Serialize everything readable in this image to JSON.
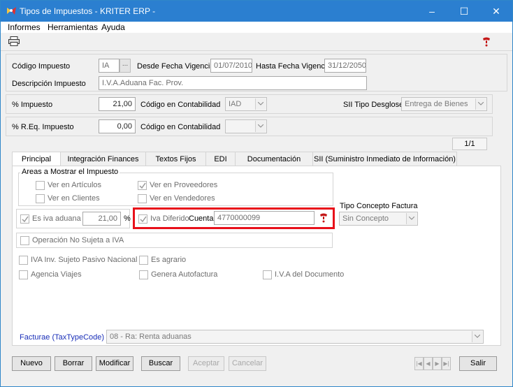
{
  "window": {
    "title": "Tipos de Impuestos - KRITER ERP -",
    "minimize": "–",
    "maximize": "☐",
    "close": "✕"
  },
  "menu": [
    "Informes",
    "Herramientas",
    "Ayuda"
  ],
  "header": {
    "codigo_label": "Código Impuesto",
    "codigo_value": "IA",
    "lookup_button": "...",
    "desde_label": "Desde Fecha Vigencia",
    "desde_value": "01/07/2010",
    "hasta_label": "Hasta Fecha Vigencia",
    "hasta_value": "31/12/2050",
    "descripcion_label": "Descripción Impuesto",
    "descripcion_value": "I.V.A.Aduana Fac. Prov."
  },
  "impuesto": {
    "pct_label": "% Impuesto",
    "pct_value": "21,00",
    "cont_label": "Código en Contabilidad",
    "cont_value": "IAD",
    "sii_label": "SII Tipo Desglose",
    "sii_value": "Entrega de Bienes"
  },
  "req": {
    "pct_label": "% R.Eq. Impuesto",
    "pct_value": "0,00",
    "cont_label": "Código en Contabilidad",
    "cont_value": ""
  },
  "record_counter": "1/1",
  "tabs": [
    "Principal",
    "Integración Finances",
    "Textos Fijos",
    "EDI",
    "Documentación",
    "SII (Suministro Inmediato de Información)"
  ],
  "principal": {
    "areas_title": "Areas a Mostrar el Impuesto",
    "areas": {
      "articulos": "Ver en Artículos",
      "proveedores": "Ver en Proveedores",
      "clientes": "Ver en Clientes",
      "vendedores": "Ver en Vendedores"
    },
    "es_iva_aduana": "Es iva aduana",
    "iva_aduana_value": "21,00",
    "pct_sign": "%",
    "iva_diferido": "Iva Diferido",
    "cuenta_label": "Cuenta",
    "cuenta_value": "4770000099",
    "tipo_concepto_label": "Tipo Concepto Factura",
    "tipo_concepto_value": "Sin Concepto",
    "operacion_no_sujeta": "Operación No Sujeta a IVA",
    "iva_inv_sujeto": "IVA Inv. Sujeto Pasivo Nacional",
    "es_agrario": "Es agrario",
    "agencia_viajes": "Agencia Viajes",
    "genera_autofactura": "Genera Autofactura",
    "iva_documento": "I.V.A del Documento",
    "facturae_label": "Facturae (TaxTypeCode)",
    "facturae_value": "08 - Ra: Renta aduanas"
  },
  "buttons": {
    "nuevo": "Nuevo",
    "borrar": "Borrar",
    "modificar": "Modificar",
    "buscar": "Buscar",
    "aceptar": "Aceptar",
    "cancelar": "Cancelar",
    "salir": "Salir"
  },
  "nav": [
    "|◀",
    "◀",
    "▶",
    "▶|"
  ],
  "colors": {
    "titlebar": "#2b7fd0",
    "highlight_box": "#e8101a",
    "link_label": "#1a2fb8"
  }
}
